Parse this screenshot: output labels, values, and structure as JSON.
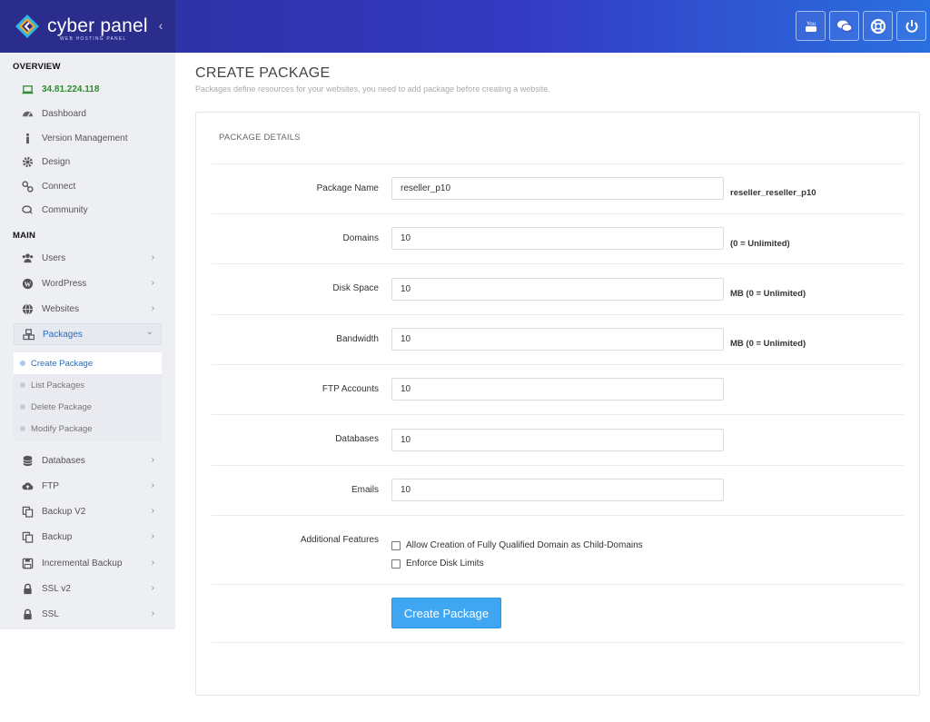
{
  "brand": {
    "name": "cyber panel",
    "tagline": "WEB HOSTING PANEL",
    "collapse_glyph": "‹"
  },
  "header_buttons": [
    {
      "name": "youtube-icon"
    },
    {
      "name": "chat-icon"
    },
    {
      "name": "support-icon"
    },
    {
      "name": "power-icon"
    }
  ],
  "sidebar": {
    "overview_title": "OVERVIEW",
    "main_title": "MAIN",
    "overview_items": [
      {
        "label": "34.81.224.118",
        "icon": "laptop-icon"
      },
      {
        "label": "Dashboard",
        "icon": "dashboard-icon"
      },
      {
        "label": "Version Management",
        "icon": "info-icon"
      },
      {
        "label": "Design",
        "icon": "cog-icon"
      },
      {
        "label": "Connect",
        "icon": "link-icon"
      },
      {
        "label": "Community",
        "icon": "comments-icon"
      }
    ],
    "main_items": [
      {
        "label": "Users",
        "icon": "users-icon"
      },
      {
        "label": "WordPress",
        "icon": "wordpress-icon"
      },
      {
        "label": "Websites",
        "icon": "globe-icon"
      },
      {
        "label": "Packages",
        "icon": "cubes-icon"
      },
      {
        "label": "Databases",
        "icon": "database-icon"
      },
      {
        "label": "FTP",
        "icon": "cloud-upload-icon"
      },
      {
        "label": "Backup V2",
        "icon": "copy-icon"
      },
      {
        "label": "Backup",
        "icon": "copy-icon"
      },
      {
        "label": "Incremental Backup",
        "icon": "save-icon"
      },
      {
        "label": "SSL v2",
        "icon": "lock-icon"
      },
      {
        "label": "SSL",
        "icon": "lock-icon"
      }
    ],
    "packages_submenu": [
      {
        "label": "Create Package",
        "active": true
      },
      {
        "label": "List Packages"
      },
      {
        "label": "Delete Package"
      },
      {
        "label": "Modify Package"
      }
    ],
    "chevron_right": "›",
    "chevron_down": "⌄"
  },
  "main": {
    "title": "CREATE PACKAGE",
    "subtitle": "Packages define resources for your websites, you need to add package before creating a website.",
    "panel_title": "PACKAGE DETAILS",
    "fields": [
      {
        "label": "Package Name",
        "value": "reseller_p10",
        "hint": "reseller_reseller_p10"
      },
      {
        "label": "Domains",
        "value": "10",
        "hint": "(0 = Unlimited)"
      },
      {
        "label": "Disk Space",
        "value": "10",
        "hint": "MB (0 = Unlimited)"
      },
      {
        "label": "Bandwidth",
        "value": "10",
        "hint": "MB (0 = Unlimited)"
      },
      {
        "label": "FTP Accounts",
        "value": "10",
        "hint": ""
      },
      {
        "label": "Databases",
        "value": "10",
        "hint": ""
      },
      {
        "label": "Emails",
        "value": "10",
        "hint": ""
      }
    ],
    "additional_features_label": "Additional Features",
    "features": [
      {
        "label": "Allow Creation of Fully Qualified Domain as Child-Domains",
        "checked": false
      },
      {
        "label": "Enforce Disk Limits",
        "checked": false
      }
    ],
    "submit_label": "Create Package"
  },
  "colors": {
    "header_start": "#2c2f9a",
    "header_end": "#2a6fe0",
    "accent_blue": "#3fa6f2",
    "ip_green": "#2e8b2e",
    "active_link": "#2a6bbf"
  }
}
